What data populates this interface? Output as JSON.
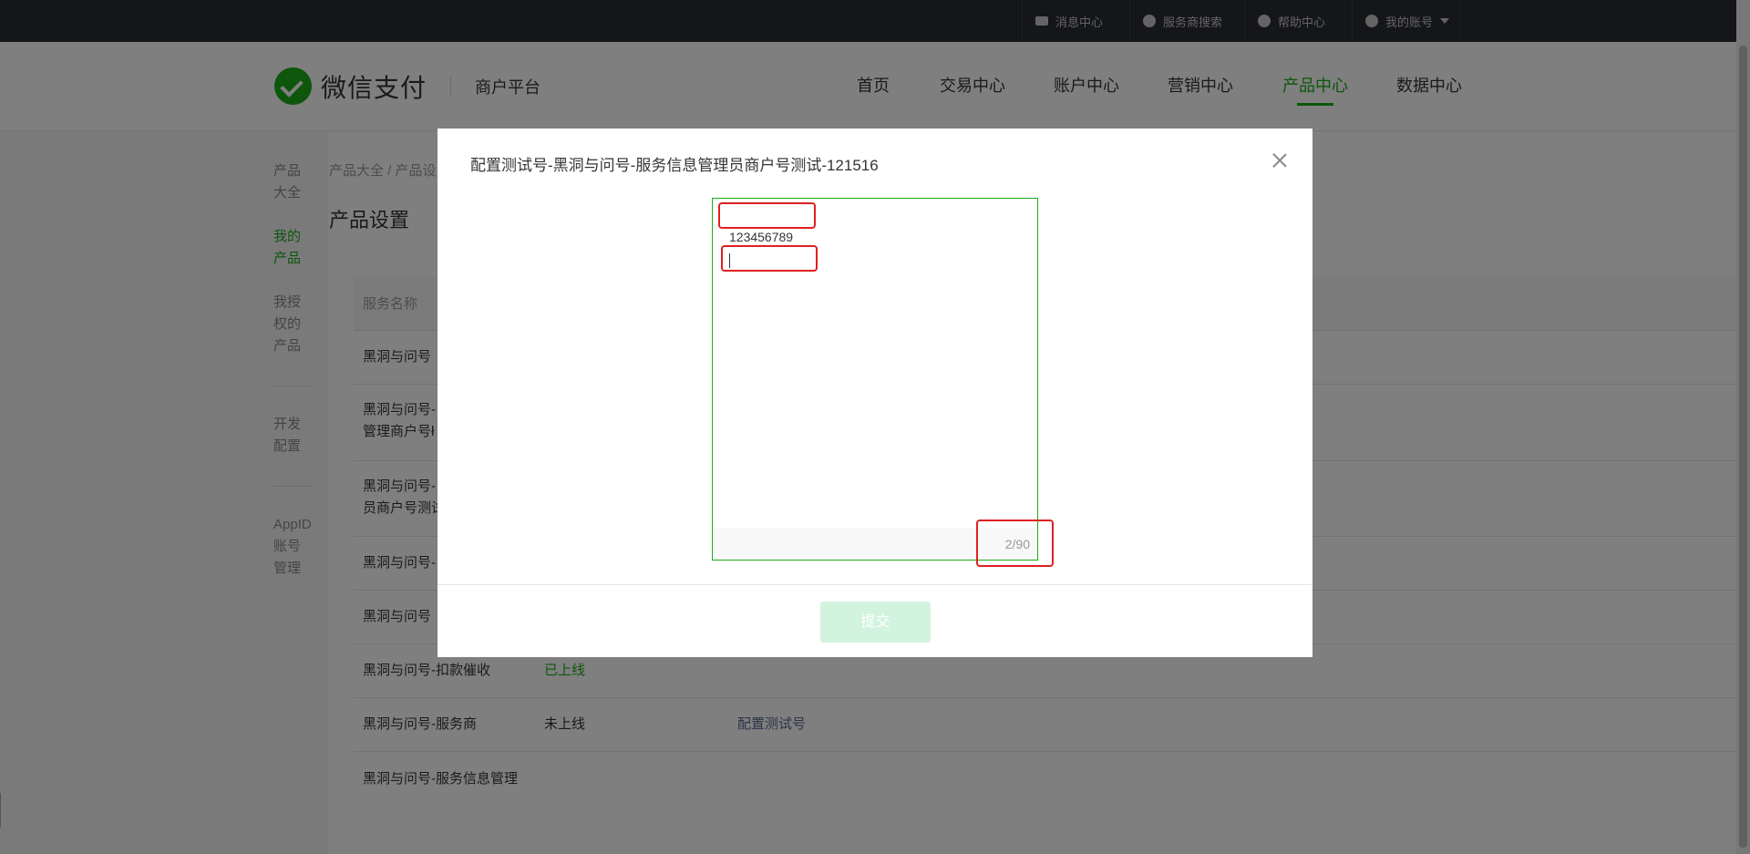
{
  "topbar": {
    "items": [
      {
        "icon": "mail-icon",
        "label": "消息中心"
      },
      {
        "icon": "search-icon",
        "label": "服务商搜索"
      },
      {
        "icon": "help-icon",
        "label": "帮助中心"
      },
      {
        "icon": "user-icon",
        "label": "我的账号"
      }
    ]
  },
  "header": {
    "brand": "微信支付",
    "subtitle": "商户平台",
    "nav": [
      "首页",
      "交易中心",
      "账户中心",
      "营销中心",
      "产品中心",
      "数据中心"
    ],
    "active_nav": "产品中心"
  },
  "sidebar": {
    "items": [
      {
        "label": "产品大全",
        "active": false
      },
      {
        "label": "我的产品",
        "active": true
      },
      {
        "label": "我授权的产品",
        "active": false
      },
      {
        "label": "开发配置",
        "active": false
      },
      {
        "label": "AppID账号管理",
        "active": false
      }
    ]
  },
  "breadcrumb": "产品大全 / 产品设",
  "page_title": "产品设置",
  "table": {
    "header": "服务名称",
    "rows": [
      {
        "name": "黑洞与问号",
        "status": "",
        "action": ""
      },
      {
        "name": "黑洞与问号-\n管理商户号ł",
        "status": "",
        "action": ""
      },
      {
        "name": "黑洞与问号-\n员商户号测试",
        "status": "",
        "action": ""
      },
      {
        "name": "黑洞与问号-",
        "status": "",
        "action": ""
      },
      {
        "name": "黑洞与问号",
        "status": "",
        "action": ""
      },
      {
        "name": "黑洞与问号-扣款催收",
        "status": "已上线",
        "action": ""
      },
      {
        "name": "黑洞与问号-服务商",
        "status": "未上线",
        "action": "配置测试号"
      },
      {
        "name": "黑洞与问号-服务信息管理",
        "status": "",
        "action": ""
      }
    ]
  },
  "dialog": {
    "title": "配置测试号-黑洞与问号-服务信息管理员商户号测试-121516",
    "textarea_lines": [
      "",
      "123456789",
      ""
    ],
    "counter": "2/90",
    "submit_label": "提交",
    "colors": {
      "accent": "#1aad19",
      "highlight": "#e02020",
      "submit_disabled": "#d2f3dd"
    }
  }
}
